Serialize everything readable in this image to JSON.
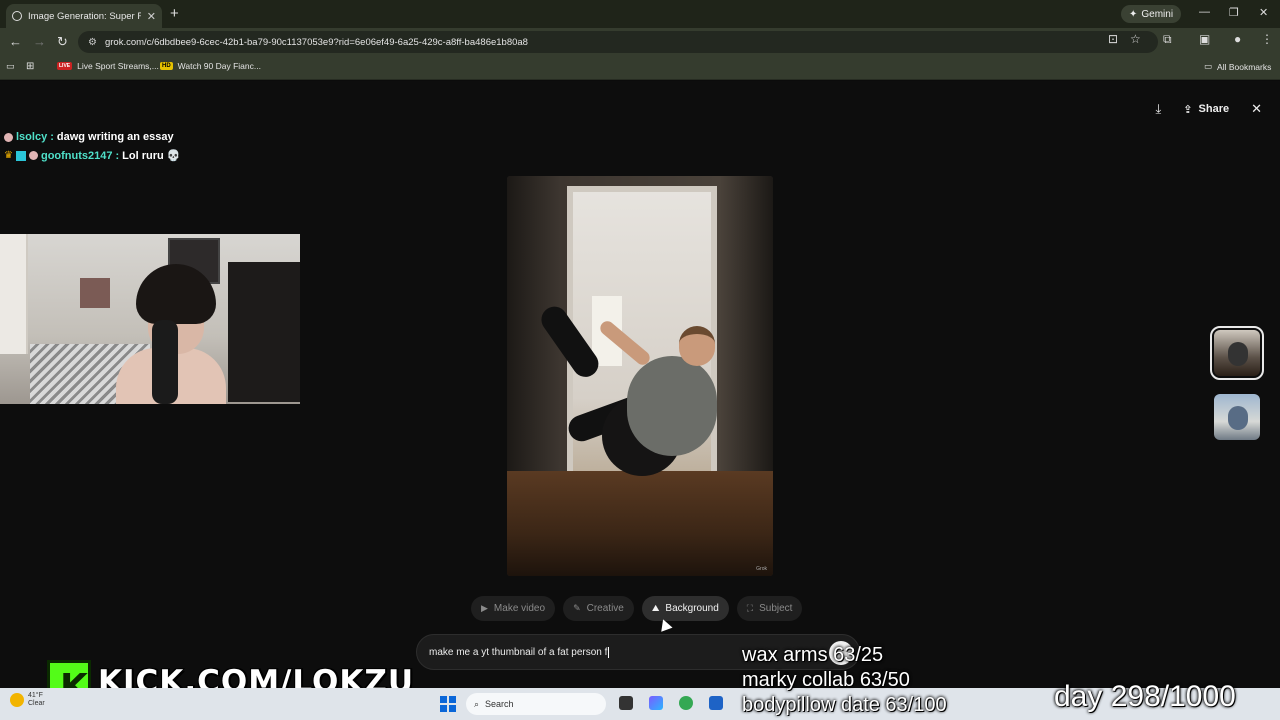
{
  "browser": {
    "tab_title": "Image Generation: Super Fat Pe",
    "url": "grok.com/c/6dbdbee9-6cec-42b1-ba79-90c1137053e9?rid=6e06ef49-6a25-429c-a8ff-ba486e1b80a8",
    "gemini_label": "Gemini",
    "bookmarks": [
      {
        "label": "Live Sport Streams,..."
      },
      {
        "label": "Watch 90 Day Fianc..."
      }
    ],
    "all_bookmarks_label": "All Bookmarks"
  },
  "page": {
    "share_label": "Share",
    "chips": [
      {
        "label": "Make video",
        "icon": "play-icon",
        "active": false
      },
      {
        "label": "Creative",
        "icon": "brush-icon",
        "active": false
      },
      {
        "label": "Background",
        "icon": "mountain-icon",
        "active": true
      },
      {
        "label": "Subject",
        "icon": "focus-icon",
        "active": false
      }
    ],
    "prompt_value": "make me a yt thumbnail of a fat person f",
    "image_watermark": "Grok"
  },
  "chat": {
    "messages": [
      {
        "user": "lsolcy",
        "text": "dawg writing an essay"
      },
      {
        "user": "goofnuts2147",
        "text": "Lol ruru"
      }
    ]
  },
  "overlay": {
    "goals": [
      "wax arms 63/25",
      "marky collab 63/50",
      "bodypillow date 63/100"
    ],
    "day_counter": "day 298/1000",
    "kick_url": "KICK.COM/LOKZU"
  },
  "taskbar": {
    "search_placeholder": "Search",
    "weather_temp": "41°F",
    "weather_cond": "Clear"
  }
}
